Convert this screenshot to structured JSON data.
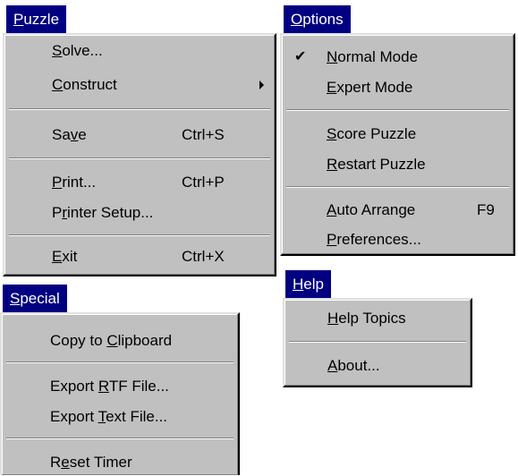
{
  "puzzle": {
    "title": {
      "ul": "P",
      "rest": "uzzle"
    },
    "solve": {
      "pre": "",
      "ul": "S",
      "post": "olve..."
    },
    "construct": {
      "pre": "",
      "ul": "C",
      "post": "onstruct"
    },
    "save": {
      "pre": "Sa",
      "ul": "v",
      "post": "e",
      "shortcut": "Ctrl+S"
    },
    "print": {
      "pre": "",
      "ul": "P",
      "post": "rint...",
      "shortcut": "Ctrl+P"
    },
    "printer_setup": {
      "pre": "P",
      "ul": "r",
      "post": "inter Setup..."
    },
    "exit": {
      "pre": "",
      "ul": "E",
      "post": "xit",
      "shortcut": "Ctrl+X"
    }
  },
  "options": {
    "title": {
      "ul": "O",
      "rest": "ptions"
    },
    "check_glyph": "✔",
    "normal_mode": {
      "pre": "",
      "ul": "N",
      "post": "ormal Mode"
    },
    "expert_mode": {
      "pre": "",
      "ul": "E",
      "post": "xpert Mode"
    },
    "score_puzzle": {
      "pre": "",
      "ul": "S",
      "post": "core Puzzle"
    },
    "restart_puzzle": {
      "pre": "",
      "ul": "R",
      "post": "estart Puzzle"
    },
    "auto_arrange": {
      "pre": "",
      "ul": "A",
      "post": "uto Arrange",
      "shortcut": "F9"
    },
    "preferences": {
      "pre": "",
      "ul": "P",
      "post": "references..."
    }
  },
  "special": {
    "title": {
      "ul": "S",
      "rest": "pecial"
    },
    "copy_clipboard": {
      "pre": "Copy to ",
      "ul": "C",
      "post": "lipboard"
    },
    "export_rtf": {
      "pre": "Export ",
      "ul": "R",
      "post": "TF File..."
    },
    "export_text": {
      "pre": "Export ",
      "ul": "T",
      "post": "ext File..."
    },
    "reset_timer": {
      "pre": "R",
      "ul": "e",
      "post": "set Timer"
    }
  },
  "help": {
    "title": {
      "ul": "H",
      "rest": "elp"
    },
    "help_topics": {
      "pre": "",
      "ul": "H",
      "post": "elp Topics"
    },
    "about": {
      "pre": "",
      "ul": "A",
      "post": "bout..."
    }
  },
  "icons": {
    "submenu_arrow": "chevron-right-icon",
    "check": "check-icon"
  },
  "colors": {
    "title_bg": "#000080",
    "title_fg": "#ffffff",
    "menu_bg": "#c0c0c0"
  }
}
